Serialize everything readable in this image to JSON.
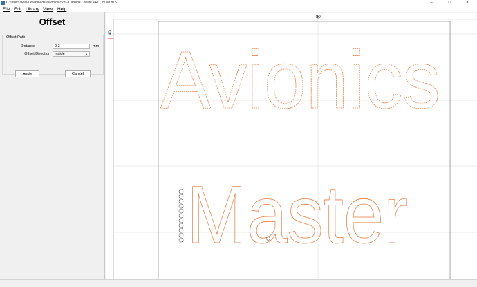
{
  "window": {
    "title": "C:/Users/willa/Downloads/avionics.c2d - Carbide Create PRO, Build 815",
    "app_icon": "carbide-create-icon",
    "controls": [
      "–",
      "□",
      "✕"
    ]
  },
  "menu": {
    "items": [
      "File",
      "Edit",
      "Library",
      "View",
      "Help"
    ]
  },
  "panel": {
    "title": "Offset",
    "group_label": "Offset Path",
    "distance_label": "Distance",
    "distance_value": "0.3",
    "distance_unit": "mm",
    "direction_label": "Offset Direction",
    "direction_value": "Inside",
    "apply_label": "Apply",
    "cancel_label": "Cancel"
  },
  "canvas": {
    "ruler_top_label": "80",
    "ruler_left_label": "40",
    "text_line1": "Avionics",
    "text_line2": "Master",
    "colors": {
      "path": "#e87b3c",
      "grid": "#e4e4e4",
      "border": "#9a9a9a",
      "marker": "#ff3b3b"
    }
  }
}
